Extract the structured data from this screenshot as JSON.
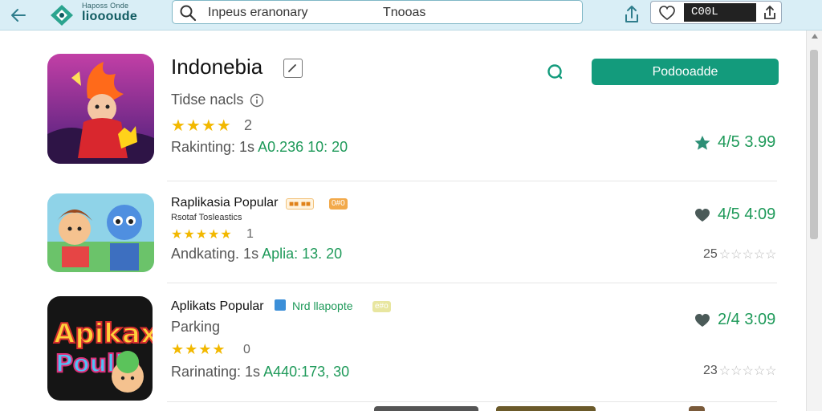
{
  "header": {
    "brand_top": "Haposs Onde",
    "brand_main": "lioooude",
    "search_text": "Inpeus eranonary",
    "search_right_text": "Tnooas",
    "account_value": "C00L"
  },
  "featured": {
    "title": "Indonebia",
    "subtitle": "Tidse nacls",
    "stars": "★★★★",
    "rating": "2",
    "meta_label": "Rakinting: 1s",
    "meta_value": "A0.236 10: 20",
    "install_label": "Podooadde",
    "price": "4/5 3.99"
  },
  "list": [
    {
      "title": "Raplikasia Popular",
      "subtitle": "Rsotaf Tosleastics",
      "badge1": "■■ ■■",
      "badge2": "0#0",
      "stars": "★★★★★",
      "rating": "1",
      "meta_label": "Andkating. 1s",
      "meta_value": "Aplia: 13. 20",
      "price": "4/5 4:09",
      "small_count": "25"
    },
    {
      "title": "Aplikats Popular",
      "subtitle": "Parking",
      "badge1": "Nrd llapopte",
      "badge2": "e#o",
      "stars": "★★★★",
      "rating": "0",
      "meta_label": "Rarinating: 1s",
      "meta_value": "A440:173, 30",
      "price": "2/4 3:09",
      "small_count": "23"
    }
  ],
  "icons": {
    "featured": "cartoon-hero-icon",
    "second": "cartoon-friends-icon",
    "third": "apikax-poulle-icon"
  },
  "colors": {
    "accent": "#139b7c",
    "price_green": "#1f9a5a",
    "star_gold": "#f2b800",
    "header_bg": "#d9eef6"
  }
}
